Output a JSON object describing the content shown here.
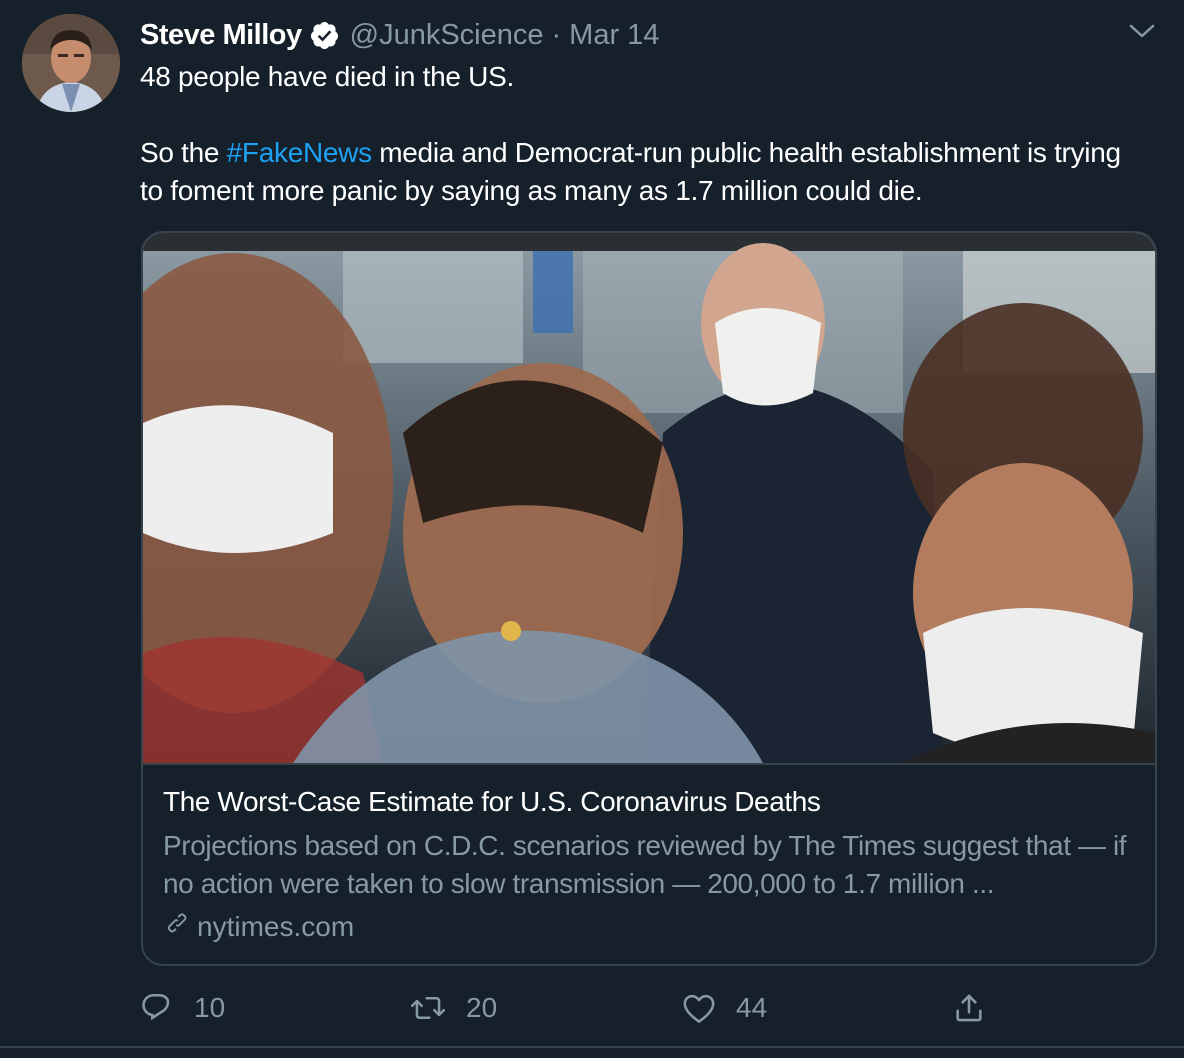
{
  "tweet": {
    "author": {
      "display_name": "Steve Milloy",
      "handle": "@JunkScience",
      "verified": true
    },
    "separator": "·",
    "date": "Mar 14",
    "text": {
      "line1": "48 people have died in the US.",
      "para2_before": "So the ",
      "hashtag": "#FakeNews",
      "para2_after": " media and Democrat-run public health establishment is trying to foment more panic by saying as many as 1.7 million could die."
    },
    "card": {
      "title": "The Worst-Case Estimate for U.S. Coronavirus Deaths",
      "description": "Projections based on C.D.C. scenarios reviewed by The Times suggest that — if no action were taken to slow transmission — 200,000 to 1.7 million ...",
      "domain": "nytimes.com"
    },
    "actions": {
      "replies": "10",
      "retweets": "20",
      "likes": "44"
    }
  },
  "colors": {
    "background": "#15202b",
    "text_primary": "#ffffff",
    "text_secondary": "#8899a6",
    "accent": "#1da1f2",
    "border": "#38444d"
  },
  "icons": [
    "verified-badge-icon",
    "chevron-down-icon",
    "link-icon",
    "reply-icon",
    "retweet-icon",
    "like-icon",
    "share-icon"
  ]
}
